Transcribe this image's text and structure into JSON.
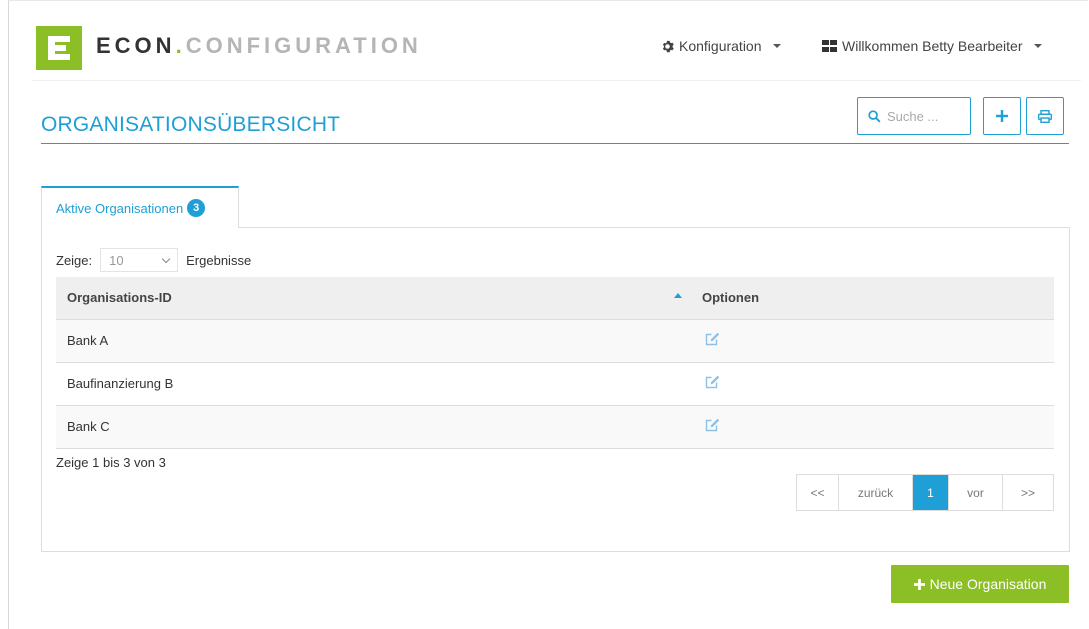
{
  "brand": {
    "name_bold": "ECON",
    "dot": ".",
    "name_light": "CONFIGURATION",
    "logo_letter": "E"
  },
  "topnav": {
    "config_label": "Konfiguration",
    "user_label": "Willkommen Betty Bearbeiter"
  },
  "page": {
    "title": "ORGANISATIONSÜBERSICHT"
  },
  "search": {
    "placeholder": "Suche ..."
  },
  "tab": {
    "label": "Aktive Organisationen",
    "count": "3"
  },
  "length": {
    "prefix": "Zeige:",
    "value": "10",
    "suffix": "Ergebnisse"
  },
  "table": {
    "headers": [
      "Organisations-ID",
      "Optionen"
    ],
    "rows": [
      {
        "id": "Bank A"
      },
      {
        "id": "Baufinanzierung B"
      },
      {
        "id": "Bank C"
      }
    ]
  },
  "info": "Zeige 1 bis 3 von 3",
  "pagination": {
    "first": "<<",
    "prev": "zurück",
    "current": "1",
    "next": "vor",
    "last": ">>"
  },
  "actions": {
    "new_org": "Neue Organisation"
  },
  "colors": {
    "accent": "#1e9fd6",
    "brand_green": "#8cbf26"
  }
}
